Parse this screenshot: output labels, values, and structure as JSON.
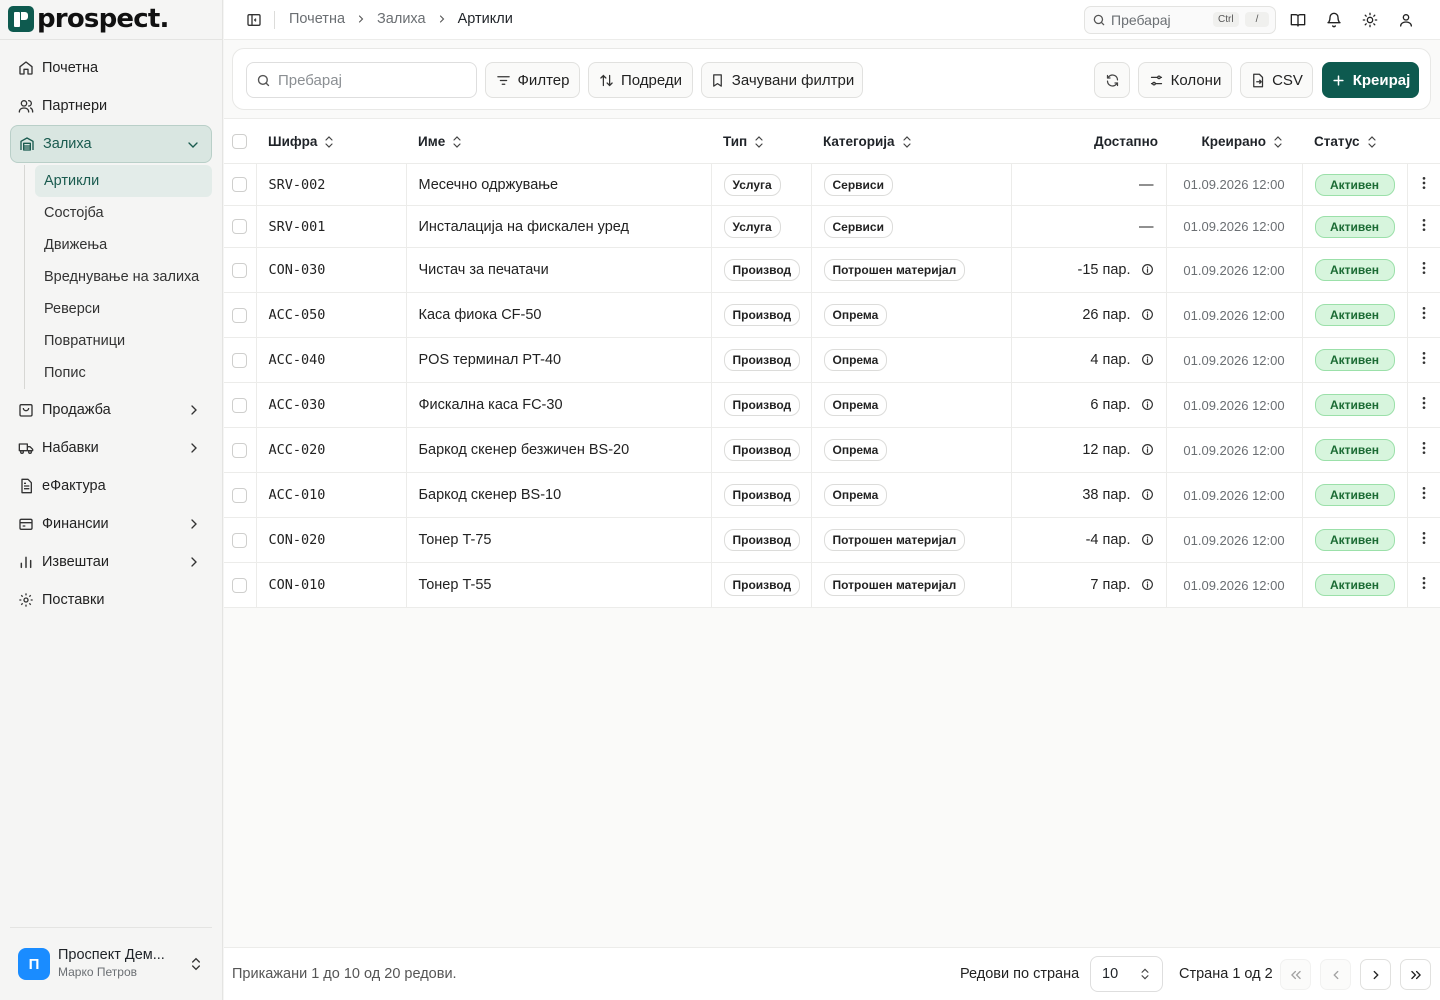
{
  "app": {
    "logo_text": "prospect."
  },
  "sidebar": {
    "items": [
      {
        "label": "Почетна",
        "icon": "home-icon"
      },
      {
        "label": "Партнери",
        "icon": "users-icon"
      },
      {
        "label": "Залиха",
        "icon": "warehouse-icon",
        "active": true,
        "expanded": true
      },
      {
        "label": "Продажба",
        "icon": "shopping-bag-icon",
        "has_submenu": true
      },
      {
        "label": "Набавки",
        "icon": "truck-icon",
        "has_submenu": true
      },
      {
        "label": "еФактура",
        "icon": "file-text-icon"
      },
      {
        "label": "Финансии",
        "icon": "wallet-icon",
        "has_submenu": true
      },
      {
        "label": "Извештаи",
        "icon": "bar-chart-icon",
        "has_submenu": true
      },
      {
        "label": "Поставки",
        "icon": "settings-icon"
      }
    ],
    "inventory_sub": [
      {
        "label": "Артикли",
        "active": true
      },
      {
        "label": "Состојба"
      },
      {
        "label": "Движења"
      },
      {
        "label": "Вреднување на залиха"
      },
      {
        "label": "Реверси"
      },
      {
        "label": "Повратници"
      },
      {
        "label": "Попис"
      }
    ],
    "user": {
      "initial": "П",
      "name": "Проспект Дем...",
      "subtitle": "Марко Петров"
    }
  },
  "topbar": {
    "breadcrumb": [
      "Почетна",
      "Залиха",
      "Артикли"
    ],
    "search_placeholder": "Пребарај",
    "shortcut_ctrl": "Ctrl",
    "shortcut_key": "/"
  },
  "toolbar": {
    "search_placeholder": "Пребарај",
    "filter_label": "Филтер",
    "sort_label": "Подреди",
    "saved_filters_label": "Зачувани филтри",
    "columns_label": "Колони",
    "csv_label": "CSV",
    "create_label": "Креирај"
  },
  "table": {
    "headers": {
      "code": "Шифра",
      "name": "Име",
      "type": "Тип",
      "category": "Категорија",
      "available": "Достапно",
      "created": "Креирано",
      "status": "Статус"
    },
    "rows": [
      {
        "code": "SRV-002",
        "name": "Месечно одржување",
        "type": "Услуга",
        "category": "Сервиси",
        "available": "—",
        "created": "01.09.2026 12:00",
        "status": "Активен"
      },
      {
        "code": "SRV-001",
        "name": "Инсталација на фискален уред",
        "type": "Услуга",
        "category": "Сервиси",
        "available": "—",
        "created": "01.09.2026 12:00",
        "status": "Активен"
      },
      {
        "code": "CON-030",
        "name": "Чистач за печатачи",
        "type": "Производ",
        "category": "Потрошен материјал",
        "available": "-15 пар.",
        "created": "01.09.2026 12:00",
        "status": "Активен"
      },
      {
        "code": "ACC-050",
        "name": "Каса фиока CF-50",
        "type": "Производ",
        "category": "Опрема",
        "available": "26 пар.",
        "created": "01.09.2026 12:00",
        "status": "Активен"
      },
      {
        "code": "ACC-040",
        "name": "POS терминал PT-40",
        "type": "Производ",
        "category": "Опрема",
        "available": "4 пар.",
        "created": "01.09.2026 12:00",
        "status": "Активен"
      },
      {
        "code": "ACC-030",
        "name": "Фискална каса FC-30",
        "type": "Производ",
        "category": "Опрема",
        "available": "6 пар.",
        "created": "01.09.2026 12:00",
        "status": "Активен"
      },
      {
        "code": "ACC-020",
        "name": "Баркод скенер безжичен BS-20",
        "type": "Производ",
        "category": "Опрема",
        "available": "12 пар.",
        "created": "01.09.2026 12:00",
        "status": "Активен"
      },
      {
        "code": "ACC-010",
        "name": "Баркод скенер BS-10",
        "type": "Производ",
        "category": "Опрема",
        "available": "38 пар.",
        "created": "01.09.2026 12:00",
        "status": "Активен"
      },
      {
        "code": "CON-020",
        "name": "Тонер T-75",
        "type": "Производ",
        "category": "Потрошен материјал",
        "available": "-4 пар.",
        "created": "01.09.2026 12:00",
        "status": "Активен"
      },
      {
        "code": "CON-010",
        "name": "Тонер T-55",
        "type": "Производ",
        "category": "Потрошен материјал",
        "available": "7 пар.",
        "created": "01.09.2026 12:00",
        "status": "Активен"
      }
    ]
  },
  "footer": {
    "showing": "Прикажани 1 до 10 од 20 редови.",
    "rows_per_page_label": "Редови по страна",
    "rows_per_page_value": "10",
    "page_info": "Страна 1 од 2"
  },
  "colors": {
    "brand": "#0e5a4f",
    "status_active_bg": "#d7f5dd",
    "status_active_text": "#1b6b34",
    "avatar": "#1a8cff"
  }
}
